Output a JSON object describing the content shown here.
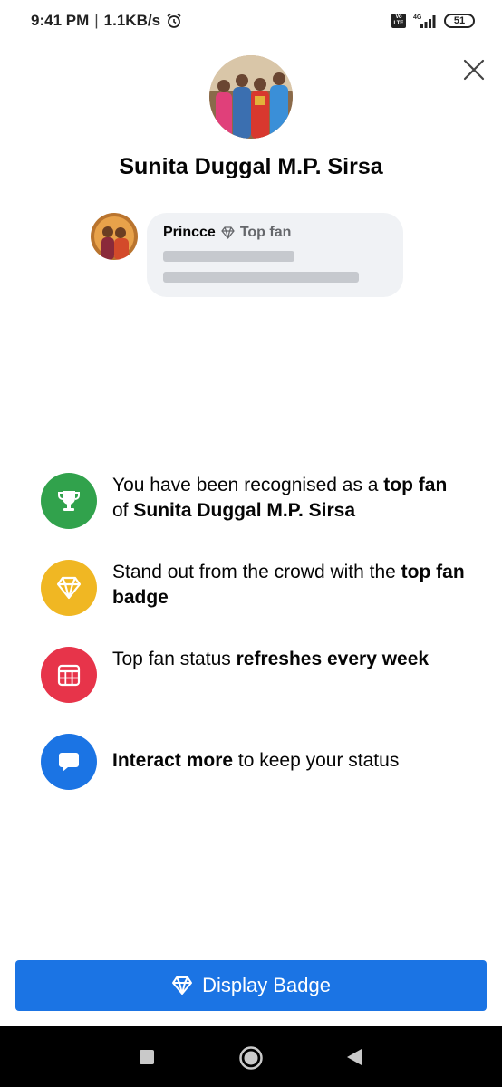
{
  "status_bar": {
    "time": "9:41 PM",
    "separator": "|",
    "speed": "1.1KB/s",
    "network": "4G",
    "battery": "51"
  },
  "page": {
    "title": "Sunita Duggal M.P. Sirsa"
  },
  "comment_preview": {
    "name": "Princce",
    "badge": "Top fan"
  },
  "features": [
    {
      "icon": "trophy-icon",
      "color": "#31a24c",
      "parts": [
        "You have been recognised as a ",
        "top fan",
        " of ",
        "Sunita Duggal M.P. Sirsa"
      ]
    },
    {
      "icon": "diamond-icon",
      "color": "#f0b723",
      "parts": [
        "Stand out from the crowd with the ",
        "top fan badge",
        "",
        ""
      ]
    },
    {
      "icon": "calendar-icon",
      "color": "#e7344a",
      "parts": [
        "Top fan status ",
        "refreshes every week",
        "",
        ""
      ]
    },
    {
      "icon": "chat-bubble-icon",
      "color": "#1b74e4",
      "parts": [
        "",
        "Interact more",
        " to keep your status",
        ""
      ]
    }
  ],
  "actions": {
    "display_badge": "Display Badge"
  },
  "colors": {
    "primary": "#1b74e4",
    "bubble": "#f0f2f5"
  }
}
